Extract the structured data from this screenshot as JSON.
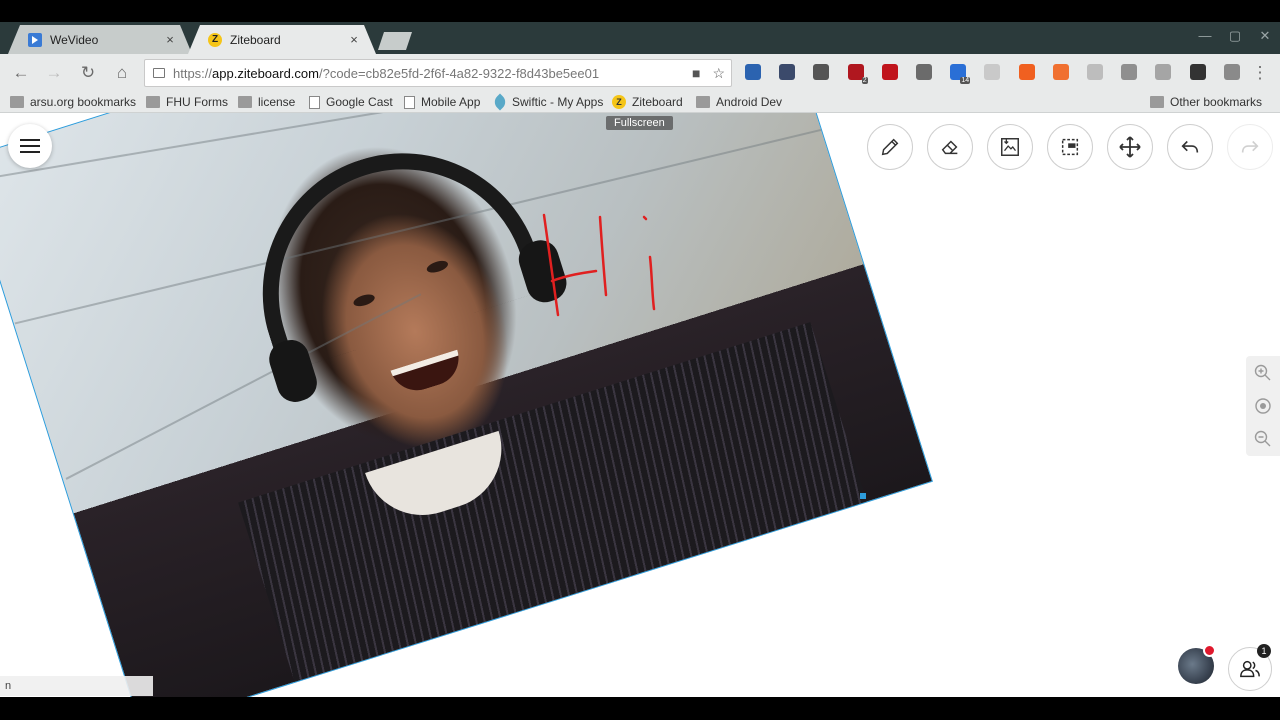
{
  "browser": {
    "tabs": [
      {
        "title": "WeVideo",
        "close": "×",
        "favicon_color": "#3a7bd5"
      },
      {
        "title": "Ziteboard",
        "close": "×",
        "favicon_letter": "Z",
        "favicon_color": "#f5c518"
      }
    ],
    "window_controls": [
      "—",
      "▢",
      "✕"
    ],
    "url": {
      "scheme": "https://",
      "host": "app.ziteboard.com",
      "path": "/?code=cb82e5fd-2f6f-4a82-9322-f8d43be5ee01"
    },
    "omnibox_icons": [
      "■",
      "☆"
    ],
    "nav": {
      "back": "←",
      "forward": "→",
      "reload": "↻",
      "home": "⌂",
      "menu": "⋮"
    },
    "extensions": [
      {
        "name": "n-icon",
        "color": "#2b63b0"
      },
      {
        "name": "cloud-icon",
        "color": "#3b4a6b"
      },
      {
        "name": "film-icon",
        "color": "#555"
      },
      {
        "name": "ublock-icon",
        "color": "#b0171f",
        "badge": "2"
      },
      {
        "name": "lock-ext-icon",
        "color": "#c0141c"
      },
      {
        "name": "bulb-icon",
        "color": "#6b6b6b"
      },
      {
        "name": "calendar-icon",
        "color": "#2a6fd6",
        "badge": "14"
      },
      {
        "name": "doc-icon",
        "color": "#c9c9c9"
      },
      {
        "name": "fire-icon",
        "color": "#f06020"
      },
      {
        "name": "puzzle-icon",
        "color": "#f07030"
      },
      {
        "name": "page-ext-icon",
        "color": "#bdbdbd"
      },
      {
        "name": "clock-icon",
        "color": "#8f8f8f"
      },
      {
        "name": "square-ext-icon",
        "color": "#a5a5a5"
      },
      {
        "name": "reel-icon",
        "color": "#333"
      },
      {
        "name": "send-icon",
        "color": "#8a8a8a"
      }
    ],
    "bookmarks": [
      {
        "label": "arsu.org bookmarks",
        "kind": "folder"
      },
      {
        "label": "FHU Forms",
        "kind": "folder"
      },
      {
        "label": "license",
        "kind": "folder"
      },
      {
        "label": "Google Cast",
        "kind": "page"
      },
      {
        "label": "Mobile App",
        "kind": "page"
      },
      {
        "label": "Swiftic - My Apps",
        "kind": "feather"
      },
      {
        "label": "Ziteboard",
        "kind": "ziteboard",
        "icon_letter": "Z"
      },
      {
        "label": "Android Dev",
        "kind": "folder"
      },
      {
        "label": "Other bookmarks",
        "kind": "folder"
      }
    ]
  },
  "board": {
    "fullscreen_tooltip": "Fullscreen",
    "tools": [
      {
        "name": "pencil-icon",
        "enabled": true
      },
      {
        "name": "eraser-icon",
        "enabled": true
      },
      {
        "name": "image-icon",
        "enabled": true
      },
      {
        "name": "select-icon",
        "enabled": true
      },
      {
        "name": "move-icon",
        "enabled": true
      },
      {
        "name": "undo-icon",
        "enabled": true
      },
      {
        "name": "redo-icon",
        "enabled": false
      }
    ],
    "ink_color": "#e02020",
    "selection_color": "#2d9cdb",
    "participants_count": "1",
    "status_text": "n"
  }
}
